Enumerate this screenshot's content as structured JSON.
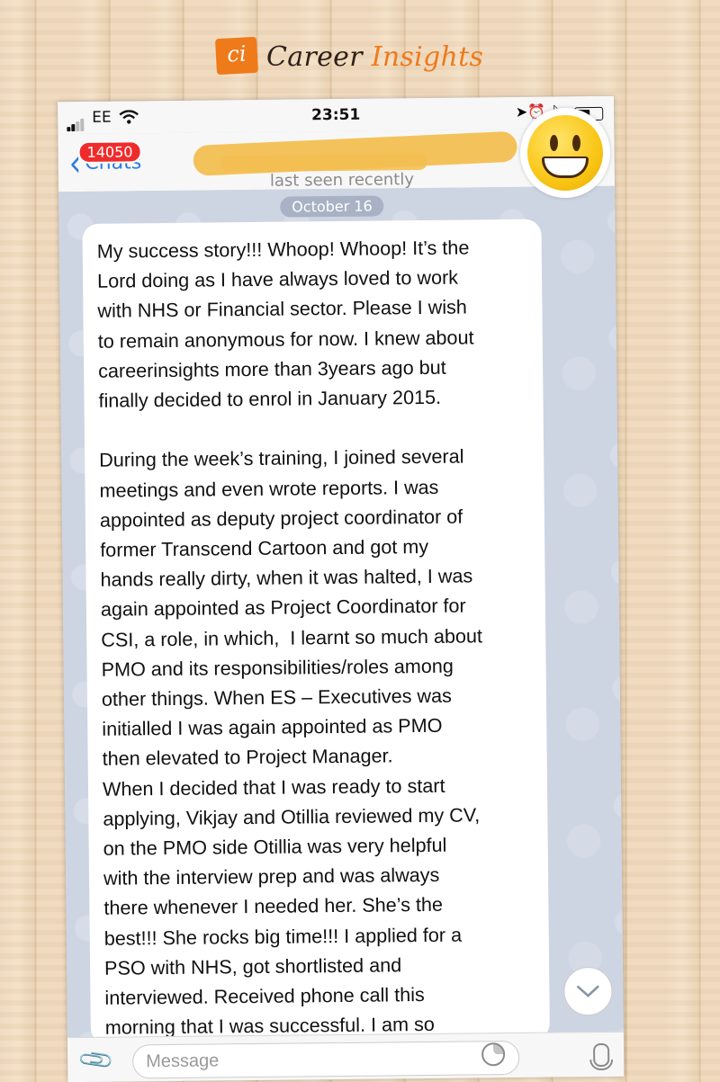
{
  "brand": {
    "badge": "ci",
    "name_part1": "Career ",
    "name_part2": "Insights"
  },
  "statusbar": {
    "carrier": "EE",
    "time": "23:51"
  },
  "chat_header": {
    "back_label": "Chats",
    "unread_badge": "14050",
    "subtitle": "last seen recently"
  },
  "date_separator": "October 16",
  "message": {
    "text": "My success story!!! Whoop! Whoop! It’s the\nLord doing as I have always loved to work\nwith NHS or Financial sector. Please I wish\nto remain anonymous for now. I knew about\ncareerinsights more than 3years ago but\nfinally decided to enrol in January 2015.\n\nDuring the week’s training, I joined several\nmeetings and even wrote reports. I was\nappointed as deputy project coordinator of\nformer Transcend Cartoon and got my\nhands really dirty, when it was halted, I was\nagain appointed as Project Coordinator for\nCSI, a role, in which,  I learnt so much about\nPMO and its responsibilities/roles among\nother things. When ES – Executives was\ninitialled I was again appointed as PMO\nthen elevated to Project Manager.\nWhen I decided that I was ready to start\napplying, Vikjay and Otillia reviewed my CV,\non the PMO side Otillia was very helpful\nwith the interview prep and was always\nthere whenever I needed her. She’s the\nbest!!! She rocks big time!!! I applied for a\nPSO with NHS, got shortlisted and\ninterviewed. Received phone call this\nmorning that I was successful. I am so"
  },
  "composer": {
    "placeholder": "Message"
  },
  "icons": {
    "back": "chevron-left-icon",
    "attach": "paperclip-icon",
    "sticker": "sticker-icon",
    "mic": "microphone-icon",
    "scroll": "chevron-down-icon",
    "emoji": "grinning-face-icon"
  },
  "colors": {
    "accent_blue": "#2a7de1",
    "brand_orange": "#ef7a1a",
    "badge_red": "#f02b2b",
    "redaction": "#f3bf52"
  }
}
